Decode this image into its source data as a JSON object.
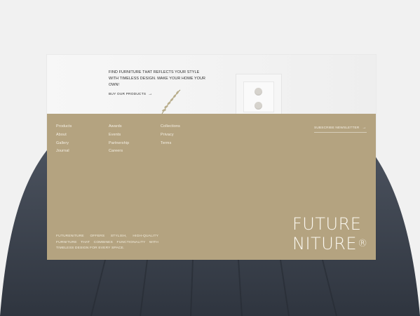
{
  "hero": {
    "tagline": "FIND FURNITURE THAT REFLECTS YOUR STYLE WITH TIMELESS DESIGN. MAKE YOUR HOME YOUR OWN!",
    "cta_label": "BUY OUR PRODUCTS",
    "cta_arrow": "→"
  },
  "footer": {
    "columns": [
      [
        "Products",
        "About",
        "Gallery",
        "Journal"
      ],
      [
        "Awards",
        "Events",
        "Partnership",
        "Careers"
      ],
      [
        "Collections",
        "Privacy",
        "Terms"
      ]
    ],
    "subscribe_label": "SUBSCRIBE NEWSLETTER",
    "subscribe_arrow": "→",
    "description": "FUTURENITURE OFFERS STYLISH, HIGH-QUALITY FURNITURE THAT COMBINES FUNCTIONALITY WITH TIMELESS DESIGN FOR EVERY SPACE.",
    "brand_line1": "FUTURE",
    "brand_line2": "NITURE",
    "brand_mark": "®"
  },
  "colors": {
    "footer_bg": "#b4a380",
    "page_bg": "#f1f1f1",
    "chair": "#3f4653"
  },
  "icons": [
    "arrow-right-icon",
    "plant-decoration",
    "wall-frame-decoration"
  ]
}
